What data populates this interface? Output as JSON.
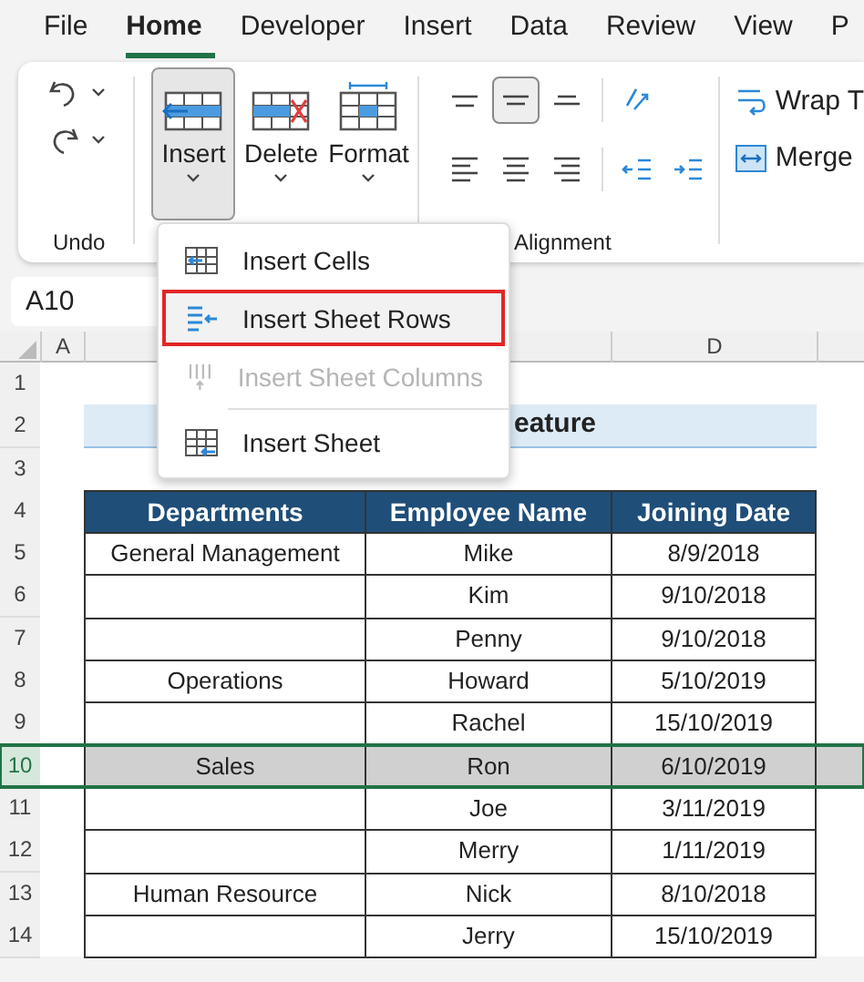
{
  "tabs": [
    {
      "label": "File",
      "selected": false
    },
    {
      "label": "Home",
      "selected": true
    },
    {
      "label": "Developer",
      "selected": false
    },
    {
      "label": "Insert",
      "selected": false
    },
    {
      "label": "Data",
      "selected": false
    },
    {
      "label": "Review",
      "selected": false
    },
    {
      "label": "View",
      "selected": false
    },
    {
      "label": "P",
      "selected": false
    }
  ],
  "ribbon": {
    "undo_label": "Undo",
    "cell_buttons": [
      {
        "label": "Insert",
        "kind": "insert",
        "pressed": true
      },
      {
        "label": "Delete",
        "kind": "delete",
        "pressed": false
      },
      {
        "label": "Format",
        "kind": "format",
        "pressed": false
      }
    ],
    "align_rows": [
      [
        {
          "kind": "top",
          "pressed": false
        },
        {
          "kind": "middle",
          "pressed": true
        },
        {
          "kind": "bottom",
          "pressed": false
        },
        {
          "kind": "orientation",
          "pressed": false
        }
      ],
      [
        {
          "kind": "left",
          "pressed": false
        },
        {
          "kind": "center",
          "pressed": false
        },
        {
          "kind": "right",
          "pressed": false
        },
        {
          "kind": "outdent",
          "pressed": false
        },
        {
          "kind": "indent",
          "pressed": false
        }
      ]
    ],
    "wrap_text": "Wrap T",
    "merge": "Merge",
    "alignment_label": "Alignment"
  },
  "name_box": "A10",
  "insert_menu": [
    {
      "label": "Insert Cells",
      "kind": "cells",
      "highlighted": false,
      "disabled": false
    },
    {
      "label": "Insert Sheet Rows",
      "kind": "rows",
      "highlighted": true,
      "disabled": false
    },
    {
      "label": "Insert Sheet Columns",
      "kind": "columns",
      "highlighted": false,
      "disabled": true
    },
    {
      "label": "Insert Sheet",
      "kind": "sheet",
      "highlighted": false,
      "disabled": false
    }
  ],
  "column_headers": [
    "A",
    "D"
  ],
  "rows": [
    {
      "number": "1",
      "kind": "empty",
      "selected": false
    },
    {
      "number": "2",
      "kind": "title",
      "selected": false,
      "title": "eature"
    },
    {
      "number": "3",
      "kind": "empty",
      "selected": false
    },
    {
      "number": "4",
      "kind": "header",
      "selected": false,
      "cells": [
        "Departments",
        "Employee Name",
        "Joining Date"
      ]
    },
    {
      "number": "5",
      "kind": "data",
      "selected": false,
      "cells": [
        "General Management",
        "Mike",
        "8/9/2018"
      ]
    },
    {
      "number": "6",
      "kind": "data",
      "selected": false,
      "cells": [
        null,
        "Kim",
        "9/10/2018"
      ]
    },
    {
      "number": "7",
      "kind": "data",
      "selected": false,
      "cells": [
        null,
        "Penny",
        "9/10/2018"
      ]
    },
    {
      "number": "8",
      "kind": "data",
      "selected": false,
      "cells": [
        "Operations",
        "Howard",
        "5/10/2019"
      ]
    },
    {
      "number": "9",
      "kind": "data",
      "selected": false,
      "cells": [
        null,
        "Rachel",
        "15/10/2019"
      ]
    },
    {
      "number": "10",
      "kind": "data",
      "selected": true,
      "cells": [
        "Sales",
        "Ron",
        "6/10/2019"
      ]
    },
    {
      "number": "11",
      "kind": "data",
      "selected": false,
      "cells": [
        null,
        "Joe",
        "3/11/2019"
      ]
    },
    {
      "number": "12",
      "kind": "data",
      "selected": false,
      "cells": [
        null,
        "Merry",
        "1/11/2019"
      ]
    },
    {
      "number": "13",
      "kind": "data",
      "selected": false,
      "cells": [
        "Human Resource",
        "Nick",
        "8/10/2018"
      ]
    },
    {
      "number": "14",
      "kind": "data",
      "selected": false,
      "cells": [
        null,
        "Jerry",
        "15/10/2019"
      ]
    }
  ]
}
